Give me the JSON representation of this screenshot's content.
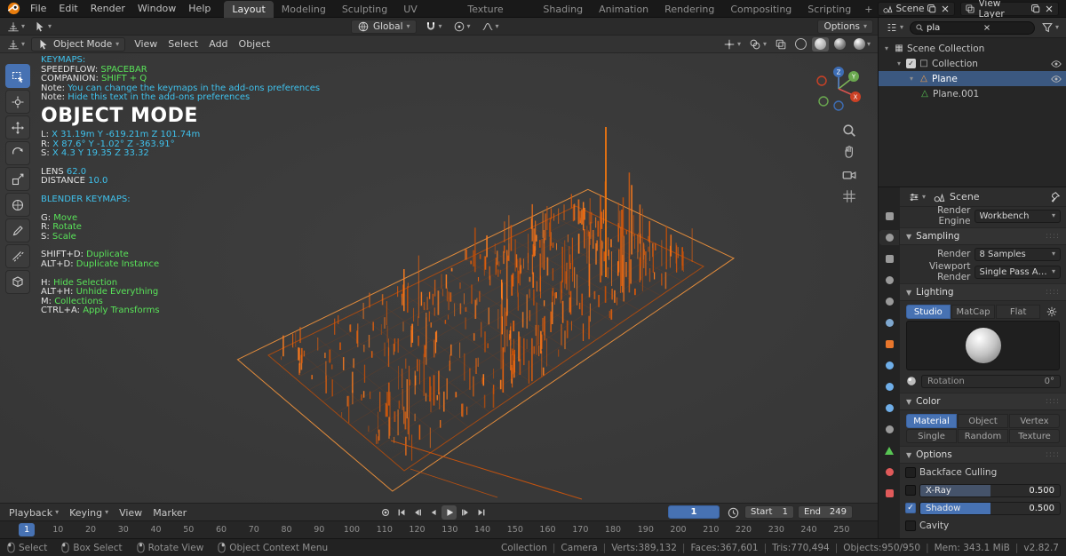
{
  "colors": {
    "accent_blue": "#4772b3",
    "text_cyan": "#3fc1ec",
    "text_green": "#59e359",
    "wire_orange": "#e8620c",
    "selection_orange": "#ff9a3c"
  },
  "topbar": {
    "menus": [
      "File",
      "Edit",
      "Render",
      "Window",
      "Help"
    ],
    "workspaces": [
      "Layout",
      "Modeling",
      "Sculpting",
      "UV Editing",
      "Texture Paint",
      "Shading",
      "Animation",
      "Rendering",
      "Compositing",
      "Scripting"
    ],
    "active_workspace": "Layout",
    "add_workspace_label": "+",
    "scene_selector": {
      "label": "Scene"
    },
    "view_layer_selector": {
      "label": "View Layer"
    }
  },
  "tool_settings": {
    "orientation": "Global",
    "options_label": "Options"
  },
  "viewport_header": {
    "mode": "Object Mode",
    "menus": [
      "View",
      "Select",
      "Add",
      "Object"
    ]
  },
  "viewport": {
    "gizmo": {
      "x": "X",
      "y": "Y",
      "z": "Z"
    },
    "toolbar": [
      {
        "name": "select-box-tool",
        "icon": "tool-select",
        "active": true
      },
      {
        "name": "cursor-tool",
        "icon": "tool-cursor"
      },
      {
        "name": "move-tool",
        "icon": "tool-move"
      },
      {
        "name": "rotate-tool",
        "icon": "tool-rotate"
      },
      {
        "name": "scale-tool",
        "icon": "tool-scale"
      },
      {
        "name": "transform-tool",
        "icon": "tool-transform"
      },
      {
        "name": "annotate-tool",
        "icon": "tool-annotate"
      },
      {
        "name": "measure-tool",
        "icon": "tool-measure"
      },
      {
        "name": "add-cube-tool",
        "icon": "tool-addcube"
      }
    ],
    "overlay": {
      "lines": [
        {
          "parts": [
            {
              "t": "KEYMAPS:",
              "c": "cyan"
            }
          ]
        },
        {
          "parts": [
            {
              "t": "SPEEDFLOW: ",
              "c": "plain"
            },
            {
              "t": "SPACEBAR",
              "c": "green"
            }
          ]
        },
        {
          "parts": [
            {
              "t": "COMPANION: ",
              "c": "plain"
            },
            {
              "t": "SHIFT + Q",
              "c": "green"
            }
          ]
        },
        {
          "parts": [
            {
              "t": "Note: ",
              "c": "plain"
            },
            {
              "t": "You can change the keymaps in the add-ons preferences",
              "c": "cyan"
            }
          ]
        },
        {
          "parts": [
            {
              "t": "Note: ",
              "c": "plain"
            },
            {
              "t": "Hide this text in the add-ons preferences",
              "c": "cyan"
            }
          ]
        },
        {
          "title": "OBJECT MODE"
        },
        {
          "parts": [
            {
              "t": "L: ",
              "c": "plain"
            },
            {
              "t": "X 31.19m Y -619.21m Z 101.74m",
              "c": "cyan"
            }
          ]
        },
        {
          "parts": [
            {
              "t": "R: ",
              "c": "plain"
            },
            {
              "t": "X 87.6° Y -1.02° Z -363.91°",
              "c": "cyan"
            }
          ]
        },
        {
          "parts": [
            {
              "t": "S: ",
              "c": "plain"
            },
            {
              "t": "X 4.3 Y 19.35 Z 33.32",
              "c": "cyan"
            }
          ]
        },
        {
          "gap": true
        },
        {
          "parts": [
            {
              "t": "LENS ",
              "c": "plain"
            },
            {
              "t": "62.0",
              "c": "cyan"
            }
          ]
        },
        {
          "parts": [
            {
              "t": "DISTANCE ",
              "c": "plain"
            },
            {
              "t": "10.0",
              "c": "cyan"
            }
          ]
        },
        {
          "gap": true
        },
        {
          "parts": [
            {
              "t": "BLENDER KEYMAPS:",
              "c": "cyan"
            }
          ]
        },
        {
          "gap": true
        },
        {
          "parts": [
            {
              "t": "G: ",
              "c": "plain"
            },
            {
              "t": "Move",
              "c": "green"
            }
          ]
        },
        {
          "parts": [
            {
              "t": "R: ",
              "c": "plain"
            },
            {
              "t": "Rotate",
              "c": "green"
            }
          ]
        },
        {
          "parts": [
            {
              "t": "S: ",
              "c": "plain"
            },
            {
              "t": "Scale",
              "c": "green"
            }
          ]
        },
        {
          "gap": true
        },
        {
          "parts": [
            {
              "t": "SHIFT+D: ",
              "c": "plain"
            },
            {
              "t": "Duplicate",
              "c": "green"
            }
          ]
        },
        {
          "parts": [
            {
              "t": "ALT+D: ",
              "c": "plain"
            },
            {
              "t": "Duplicate Instance",
              "c": "green"
            }
          ]
        },
        {
          "gap": true
        },
        {
          "parts": [
            {
              "t": "H: ",
              "c": "plain"
            },
            {
              "t": "Hide Selection",
              "c": "green"
            }
          ]
        },
        {
          "parts": [
            {
              "t": "ALT+H: ",
              "c": "plain"
            },
            {
              "t": "Unhide Everything",
              "c": "green"
            }
          ]
        },
        {
          "parts": [
            {
              "t": "M: ",
              "c": "plain"
            },
            {
              "t": "Collections",
              "c": "green"
            }
          ]
        },
        {
          "parts": [
            {
              "t": "CTRL+A: ",
              "c": "plain"
            },
            {
              "t": "Apply Transforms",
              "c": "green"
            }
          ]
        }
      ]
    },
    "scene_3d": {
      "building_count": 430,
      "object_color": "#e8620c",
      "selection_outline": "#ff9a3c",
      "building_colors": [
        "#d4560a",
        "#e8620c",
        "#f07018",
        "#c24f08",
        "#ff7d1e"
      ]
    }
  },
  "outliner": {
    "search_value": "pla",
    "rows": [
      {
        "label": "Scene Collection",
        "icon": "scene-collection",
        "glyph": "▦",
        "color": "#c8c8c8",
        "depth": 0,
        "expander": true
      },
      {
        "label": "Collection",
        "icon": "collection",
        "glyph": "□",
        "color": "#c8c8c8",
        "depth": 1,
        "expander": true,
        "checkbox": true,
        "eye": true
      },
      {
        "label": "Plane",
        "icon": "mesh-object",
        "glyph": "△",
        "color": "#f0a050",
        "depth": 2,
        "expander": true,
        "selected": true,
        "eye": true
      },
      {
        "label": "Plane.001",
        "icon": "mesh-data",
        "glyph": "△",
        "color": "#58c554",
        "depth": 3
      }
    ]
  },
  "properties": {
    "breadcrumb": "Scene",
    "tabs": [
      {
        "name": "tool",
        "shape": "square",
        "color": "#9a9a9a"
      },
      {
        "name": "render",
        "shape": "circle",
        "color": "#9a9a9a",
        "active": true
      },
      {
        "name": "output",
        "shape": "square",
        "color": "#9a9a9a"
      },
      {
        "name": "view-layer",
        "shape": "circle",
        "color": "#9a9a9a"
      },
      {
        "name": "scene",
        "shape": "circle",
        "color": "#9a9a9a"
      },
      {
        "name": "world",
        "shape": "circle",
        "color": "#7fa8d0"
      },
      {
        "name": "object",
        "shape": "square",
        "color": "#e8762c"
      },
      {
        "name": "modifiers",
        "shape": "circle",
        "color": "#6faee8"
      },
      {
        "name": "particles",
        "shape": "circle",
        "color": "#6faee8"
      },
      {
        "name": "physics",
        "shape": "circle",
        "color": "#6faee8"
      },
      {
        "name": "constraints",
        "shape": "circle",
        "color": "#9a9a9a"
      },
      {
        "name": "data",
        "shape": "triangle",
        "color": "#58c554"
      },
      {
        "name": "material",
        "shape": "circle",
        "color": "#e05a5a"
      },
      {
        "name": "texture",
        "shape": "square",
        "color": "#e05a5a"
      }
    ],
    "render_engine": {
      "label": "Render Engine",
      "value": "Workbench"
    },
    "sampling": {
      "title": "Sampling",
      "rows": [
        {
          "label": "Render",
          "value": "8 Samples"
        },
        {
          "label": "Viewport Render",
          "value": "Single Pass Anti-..."
        }
      ]
    },
    "lighting": {
      "title": "Lighting",
      "tabs": [
        "Studio",
        "MatCap",
        "Flat"
      ],
      "active": "Studio",
      "rotation_label": "Rotation",
      "rotation_value": "0°"
    },
    "color": {
      "title": "Color",
      "tabs": [
        "Material",
        "Object",
        "Vertex",
        "Single",
        "Random",
        "Texture"
      ],
      "active": "Material"
    },
    "options": {
      "title": "Options",
      "items": [
        {
          "label": "Backface Culling",
          "type": "checkbox",
          "checked": false
        },
        {
          "label": "X-Ray",
          "type": "slider",
          "checked": false,
          "value": "0.500",
          "fill": 50
        },
        {
          "label": "Shadow",
          "type": "slider",
          "checked": true,
          "value": "0.500",
          "fill": 50
        },
        {
          "label": "Cavity",
          "type": "checkbox",
          "checked": false
        }
      ]
    }
  },
  "timeline": {
    "menus": [
      {
        "label": "Playback",
        "caret": true
      },
      {
        "label": "Keying",
        "caret": true
      },
      {
        "label": "View",
        "caret": false
      },
      {
        "label": "Marker",
        "caret": false
      }
    ],
    "transport": [
      "record",
      "jump-first",
      "prev-keyframe",
      "prev-frame",
      "play",
      "next-keyframe",
      "jump-last"
    ],
    "current_frame": "1",
    "start": {
      "label": "Start",
      "value": "1"
    },
    "end": {
      "label": "End",
      "value": "249"
    },
    "ruler_frames": [
      10,
      20,
      30,
      40,
      50,
      60,
      70,
      80,
      90,
      100,
      110,
      120,
      130,
      140,
      150,
      160,
      170,
      180,
      190,
      200,
      210,
      220,
      230,
      240,
      250
    ]
  },
  "statusbar": {
    "hints": [
      {
        "label": "Select",
        "mouse": "left"
      },
      {
        "label": "Box Select",
        "mouse": "left"
      },
      {
        "label": "Rotate View",
        "mouse": "middle"
      },
      {
        "label": "Object Context Menu",
        "mouse": "right"
      }
    ],
    "stats": [
      "Collection",
      "Camera",
      "Verts:389,132",
      "Faces:367,601",
      "Tris:770,494",
      "Objects:950/950",
      "Mem: 343.1 MiB",
      "v2.82.7"
    ]
  }
}
